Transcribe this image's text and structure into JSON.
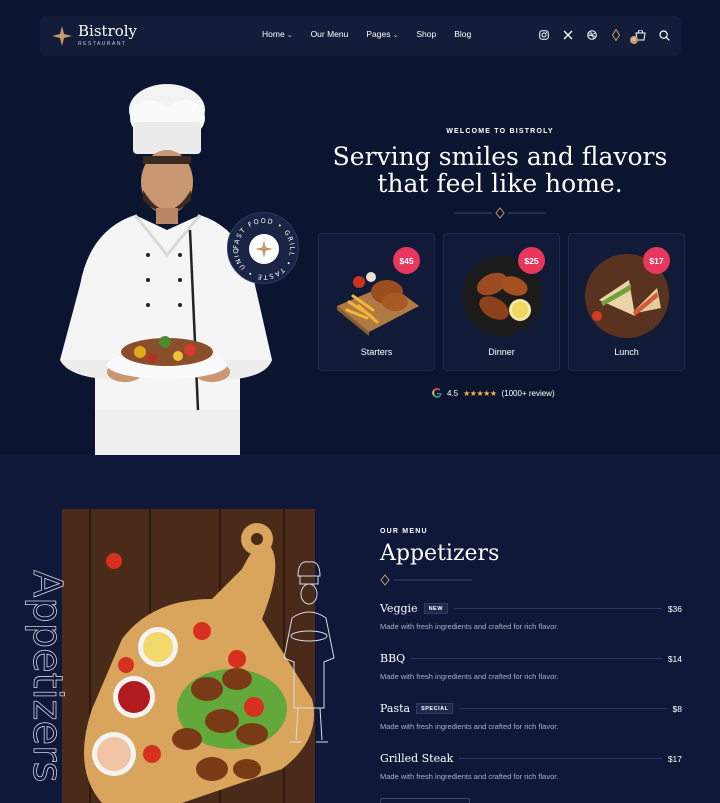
{
  "brand": {
    "name": "Bistroly",
    "tagline": "RESTAURANT"
  },
  "nav": {
    "items": [
      {
        "label": "Home",
        "dropdown": true
      },
      {
        "label": "Our Menu",
        "dropdown": false
      },
      {
        "label": "Pages",
        "dropdown": true
      },
      {
        "label": "Shop",
        "dropdown": false
      },
      {
        "label": "Blog",
        "dropdown": false
      }
    ],
    "icons": [
      "instagram-icon",
      "x-icon",
      "dribbble-icon",
      "diamond-icon",
      "cart-icon",
      "search-icon"
    ],
    "cart_count": "0"
  },
  "badge": {
    "words": [
      "FAST FOOD",
      "GRILL",
      "TASTE",
      "UNIQUE"
    ]
  },
  "hero": {
    "eyebrow": "WELCOME TO BISTROLY",
    "title_line1": "Serving smiles and flavors",
    "title_line2": "that feel like home."
  },
  "cards": [
    {
      "label": "Starters",
      "price": "$45"
    },
    {
      "label": "Dinner",
      "price": "$25"
    },
    {
      "label": "Lunch",
      "price": "$17"
    }
  ],
  "rating": {
    "score": "4.5",
    "reviews": "(1000+ review)"
  },
  "menu": {
    "eyebrow": "OUR MENU",
    "title": "Appetizers",
    "vertical_text": "Appetizers",
    "items": [
      {
        "name": "Veggie",
        "tag": "NEW",
        "price": "$36",
        "desc": "Made with fresh ingredients and crafted for rich flavor."
      },
      {
        "name": "BBQ",
        "tag": "",
        "price": "$14",
        "desc": "Made with fresh ingredients and crafted for rich flavor."
      },
      {
        "name": "Pasta",
        "tag": "SPECIAL",
        "price": "$8",
        "desc": "Made with fresh ingredients and crafted for rich flavor."
      },
      {
        "name": "Grilled Steak",
        "tag": "",
        "price": "$17",
        "desc": "Made with fresh ingredients and crafted for rich flavor."
      }
    ]
  },
  "colors": {
    "background": "#0d1631",
    "accent": "#c89b6d",
    "price_badge": "#e8375d"
  }
}
